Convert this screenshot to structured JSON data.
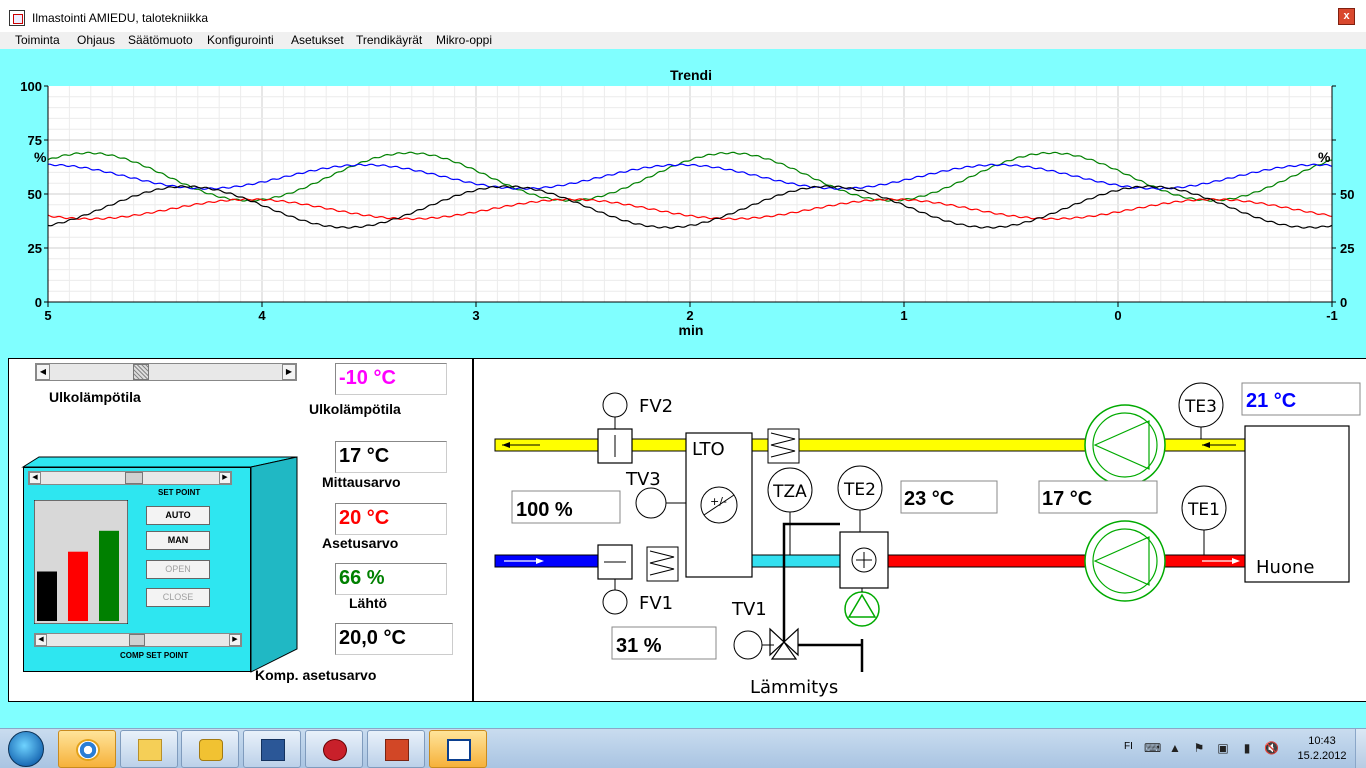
{
  "window": {
    "title": "Ilmastointi  AMIEDU, talotekniikka",
    "close_glyph": "x"
  },
  "menu": [
    "Toiminta",
    "Ohjaus",
    "Säätömuoto",
    "Konfigurointi",
    "Asetukset",
    "Trendikäyrät",
    "Mikro-oppi"
  ],
  "trend": {
    "title": "Trendi",
    "xlabel": "min",
    "unit_left": "%",
    "unit_right": "%",
    "y_ticks": [
      "100",
      "75",
      "50",
      "25",
      "0"
    ],
    "y_ticks_right": [
      "",
      "",
      "50",
      "25",
      "0"
    ],
    "x_ticks": [
      "5",
      "4",
      "3",
      "2",
      "1",
      "0",
      "-1"
    ]
  },
  "chart_data": {
    "type": "line",
    "title": "Trendi",
    "xlabel": "min",
    "ylabel": "%",
    "xlim": [
      5,
      -1
    ],
    "ylim": [
      0,
      100
    ],
    "grid": true,
    "series": [
      {
        "color": "#008000",
        "kind": "sine",
        "mean": 58,
        "amp": 11,
        "period_min": 1.5,
        "phase_at_x5": 0.125,
        "x": [
          5,
          4.25,
          3.5,
          2.75,
          2,
          1.25,
          0.5,
          -0.25,
          -1
        ],
        "y": [
          60,
          69,
          47,
          68,
          47,
          67,
          47,
          67,
          67
        ]
      },
      {
        "color": "#0000ff",
        "kind": "sine",
        "mean": 58,
        "amp": 5.5,
        "period_min": 1.48,
        "phase_at_x5": 0.25,
        "x": [
          5,
          4,
          3,
          2,
          1,
          0,
          -1
        ],
        "y": [
          59,
          56,
          56,
          58,
          62,
          54,
          56
        ]
      },
      {
        "color": "#ff0000",
        "kind": "sine",
        "mean": 43,
        "amp": 4.5,
        "period_min": 1.5,
        "phase_at_x5": 0.62,
        "x": [
          5,
          4,
          3,
          2,
          1,
          0,
          -1
        ],
        "y": [
          42,
          42,
          44,
          42,
          41,
          46,
          45
        ]
      },
      {
        "color": "#000000",
        "kind": "sine",
        "mean": 44,
        "amp": 9.5,
        "period_min": 1.5,
        "phase_at_x5": 0.82,
        "x": [
          5,
          4,
          3,
          2,
          1,
          0,
          -1
        ],
        "y": [
          36,
          53,
          38,
          36,
          52,
          52,
          37
        ]
      }
    ]
  },
  "left": {
    "outdoor_slider_label": "Ulkolämpötila",
    "outdoor_temp_value": "-10 °C",
    "outdoor_temp_label": "Ulkolämpötila",
    "measured_value": "17 °C",
    "measured_label": "Mittausarvo",
    "setpoint_value": "20 °C",
    "setpoint_label": "Asetusarvo",
    "output_value": "66 %",
    "output_label": "Lähtö",
    "comp_setpoint_value": "20,0 °C",
    "comp_setpoint_label": "Komp. asetusarvo",
    "set_point_caption": "SET POINT",
    "comp_set_point_caption": "COMP SET POINT",
    "buttons": {
      "auto": "AUTO",
      "man": "MAN",
      "open": "OPEN",
      "close": "CLOSE"
    },
    "colors": {
      "outdoor": "#ff00ff",
      "setpoint": "#ff0000",
      "output": "#008000",
      "measured": "#000000"
    },
    "bar_levels": {
      "measured": 0.45,
      "setpoint": 0.63,
      "output": 0.82
    }
  },
  "diagram": {
    "fv2": "FV2",
    "fv1": "FV1",
    "tv3": "TV3",
    "tv1": "TV1",
    "lto": "LTO",
    "tza": "TZA",
    "te2": "TE2",
    "te3": "TE3",
    "te1": "TE1",
    "room": "Huone",
    "heating": "Lämmitys",
    "tv3_value": "100 %",
    "tv1_value": "31 %",
    "te2_value": "23 °C",
    "supply_temp_value": "17 °C",
    "te3_value": "21 °C",
    "te3_color": "#0000ff"
  },
  "taskbar": {
    "lang": "FI",
    "time": "10:43",
    "date": "15.2.2012"
  }
}
